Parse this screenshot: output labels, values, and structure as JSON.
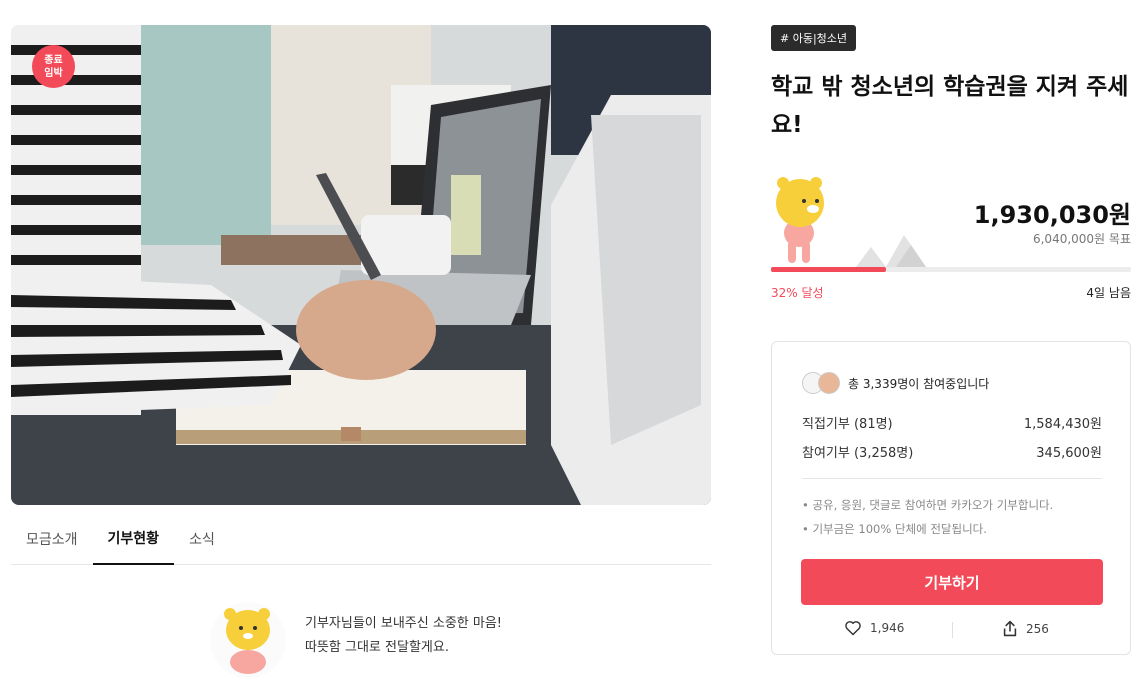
{
  "hero": {
    "badge_line1": "종료",
    "badge_line2": "임박"
  },
  "tabs": [
    {
      "label": "모금소개"
    },
    {
      "label": "기부현황"
    },
    {
      "label": "소식"
    }
  ],
  "thanks": {
    "line1": "기부자님들이 보내주신 소중한 마음!",
    "line2": "따뜻함 그대로 전달할게요."
  },
  "category": "# 아동|청소년",
  "title": "학교 밖 청소년의 학습권을 지켜 주세요!",
  "funding": {
    "amount": "1,930,030원",
    "goal": "6,040,000원 목표",
    "progress_fraction": 0.32,
    "percent_label": "32% 달성",
    "days_left": "4일 남음"
  },
  "card": {
    "participants": "총 3,339명이 참여중입니다",
    "direct_label": "직접기부 (81명)",
    "direct_value": "1,584,430원",
    "participation_label": "참여기부 (3,258명)",
    "participation_value": "345,600원",
    "note1": "• 공유, 응원, 댓글로 참여하면 카카오가 기부합니다.",
    "note2": "• 기부금은 100% 단체에 전달됩니다.",
    "donate_label": "기부하기",
    "likes": "1,946",
    "shares": "256"
  },
  "colors": {
    "accent": "#f24a58",
    "category_bg": "#2b2b2b"
  }
}
